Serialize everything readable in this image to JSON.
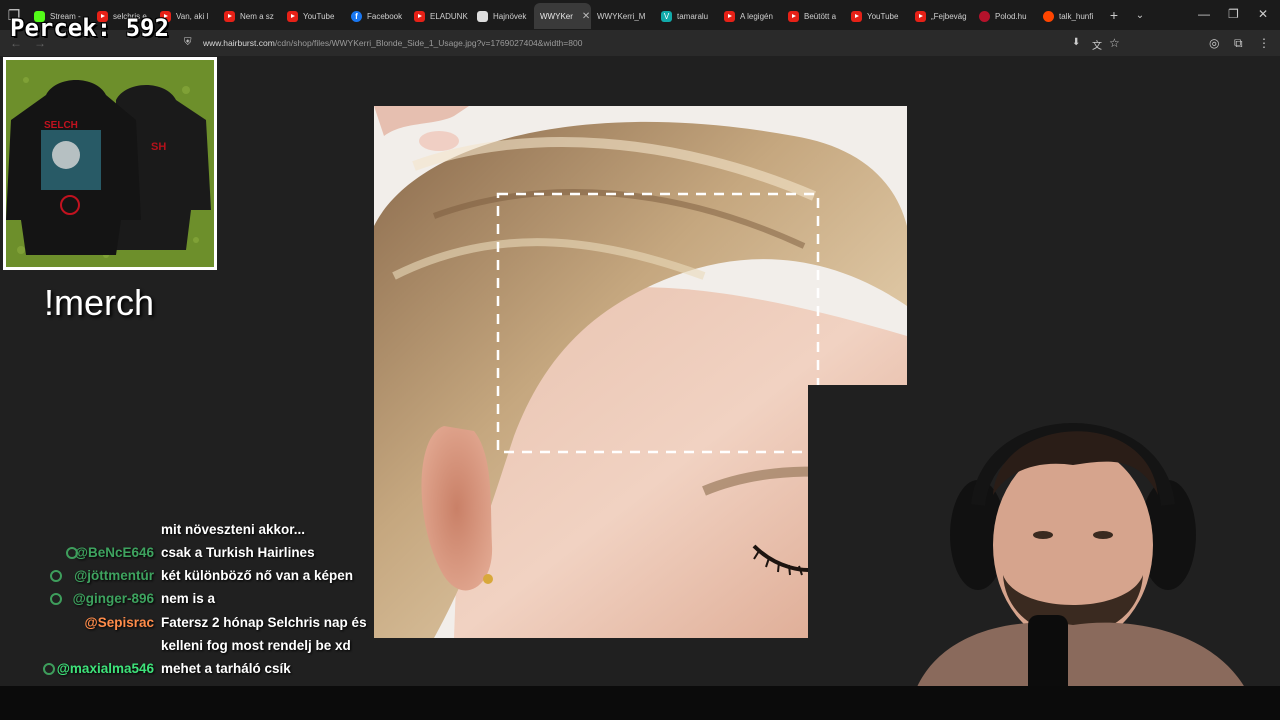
{
  "browser": {
    "tabs": [
      {
        "label": "Stream -",
        "icon": "kick"
      },
      {
        "label": "selchris e",
        "icon": "youtube"
      },
      {
        "label": "Van, aki l",
        "icon": "youtube"
      },
      {
        "label": "Nem a sz",
        "icon": "youtube"
      },
      {
        "label": "YouTube",
        "icon": "youtube"
      },
      {
        "label": "Facebook",
        "icon": "facebook"
      },
      {
        "label": "ELADUNK",
        "icon": "youtube"
      },
      {
        "label": "Hajnövek",
        "icon": "hm"
      },
      {
        "label": "WWYKer",
        "icon": "none",
        "active": true
      },
      {
        "label": "WWYKerri_M",
        "icon": "none"
      },
      {
        "label": "tamaralu",
        "icon": "v"
      },
      {
        "label": "A legigén",
        "icon": "youtube"
      },
      {
        "label": "Beütött a",
        "icon": "youtube"
      },
      {
        "label": "YouTube",
        "icon": "youtube"
      },
      {
        "label": "„Fejbevág",
        "icon": "youtube"
      },
      {
        "label": "Polod.hu",
        "icon": "polod"
      },
      {
        "label": "talk_hunfi",
        "icon": "reddit"
      }
    ],
    "url_domain": "www.hairburst.com",
    "url_path": "/cdn/shop/files/WWYKerri_Blonde_Side_1_Usage.jpg?v=1769027404&width=800"
  },
  "overlay": {
    "counter_label": "Percek:",
    "counter_value": "592",
    "merch_label": "!merch"
  },
  "chat": {
    "messages": [
      {
        "user": "",
        "text": "mit növeszteni akkor...",
        "color": "#cccccc"
      },
      {
        "user": "@BeNcE646",
        "text": "csak a Turkish Hairlines",
        "color": "#3ea35f",
        "badge": true
      },
      {
        "user": "@jöttmentúr",
        "text": "két különböző nő van a képen",
        "color": "#3ea35f",
        "badge": true
      },
      {
        "user": "@ginger-896",
        "text": "nem is a",
        "color": "#3ea35f",
        "badge": true
      },
      {
        "user": "@Sepisrac",
        "text": "Fatersz 2 hónap Selchris nap és",
        "color": "#ff8c4a",
        "badge": false
      },
      {
        "user": "",
        "text": "kelleni fog most rendelj be xd",
        "color": "#ffffff"
      },
      {
        "user": "@maxialma546",
        "text": "mehet a tarháló csík",
        "color": "#3ee37a",
        "badge": true
      }
    ]
  },
  "colors": {
    "page_bg": "#202020",
    "tab_strip": "#1b1b1b",
    "address_bar": "#2a2a2a",
    "selection_dash": "#ffffff"
  }
}
